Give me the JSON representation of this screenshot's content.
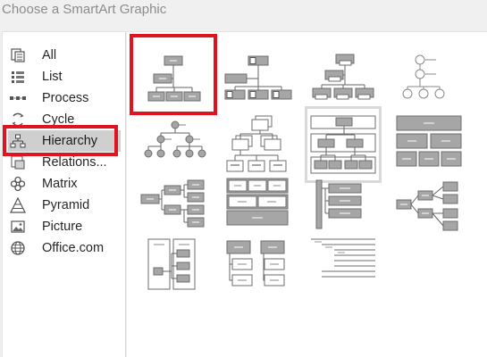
{
  "dialog": {
    "title": "Choose a SmartArt Graphic"
  },
  "colors": {
    "highlight": "#e0141e",
    "selected_bg": "#cfcfcf",
    "shape_fill": "#a6a6a6",
    "shape_stroke": "#6d6d6d"
  },
  "categories": [
    {
      "label": "All",
      "icon": "all-icon"
    },
    {
      "label": "List",
      "icon": "list-icon"
    },
    {
      "label": "Process",
      "icon": "process-icon"
    },
    {
      "label": "Cycle",
      "icon": "cycle-icon"
    },
    {
      "label": "Hierarchy",
      "icon": "hierarchy-icon",
      "selected": true
    },
    {
      "label": "Relations...",
      "icon": "relationship-icon"
    },
    {
      "label": "Matrix",
      "icon": "matrix-icon"
    },
    {
      "label": "Pyramid",
      "icon": "pyramid-icon"
    },
    {
      "label": "Picture",
      "icon": "picture-icon"
    },
    {
      "label": "Office.com",
      "icon": "globe-icon"
    }
  ],
  "gallery": {
    "layouts": [
      {
        "icon": "organization-chart-icon",
        "highlighted": true
      },
      {
        "icon": "picture-org-chart-icon"
      },
      {
        "icon": "name-title-org-chart-icon"
      },
      {
        "icon": "circle-picture-hierarchy-icon"
      },
      {
        "icon": "circle-hierarchy-icon"
      },
      {
        "icon": "stacked-hierarchy-icon"
      },
      {
        "icon": "labeled-hierarchy-icon",
        "selected": true
      },
      {
        "icon": "table-hierarchy-icon"
      },
      {
        "icon": "horizontal-hierarchy-icon"
      },
      {
        "icon": "horizontal-labeled-hierarchy-icon"
      },
      {
        "icon": "lined-list-hierarchy-icon"
      },
      {
        "icon": "horizontal-multi-level-hierarchy-icon"
      },
      {
        "icon": "architecture-layout-icon"
      },
      {
        "icon": "hierarchy-list-icon"
      },
      {
        "icon": "lined-text-hierarchy-icon"
      }
    ]
  }
}
